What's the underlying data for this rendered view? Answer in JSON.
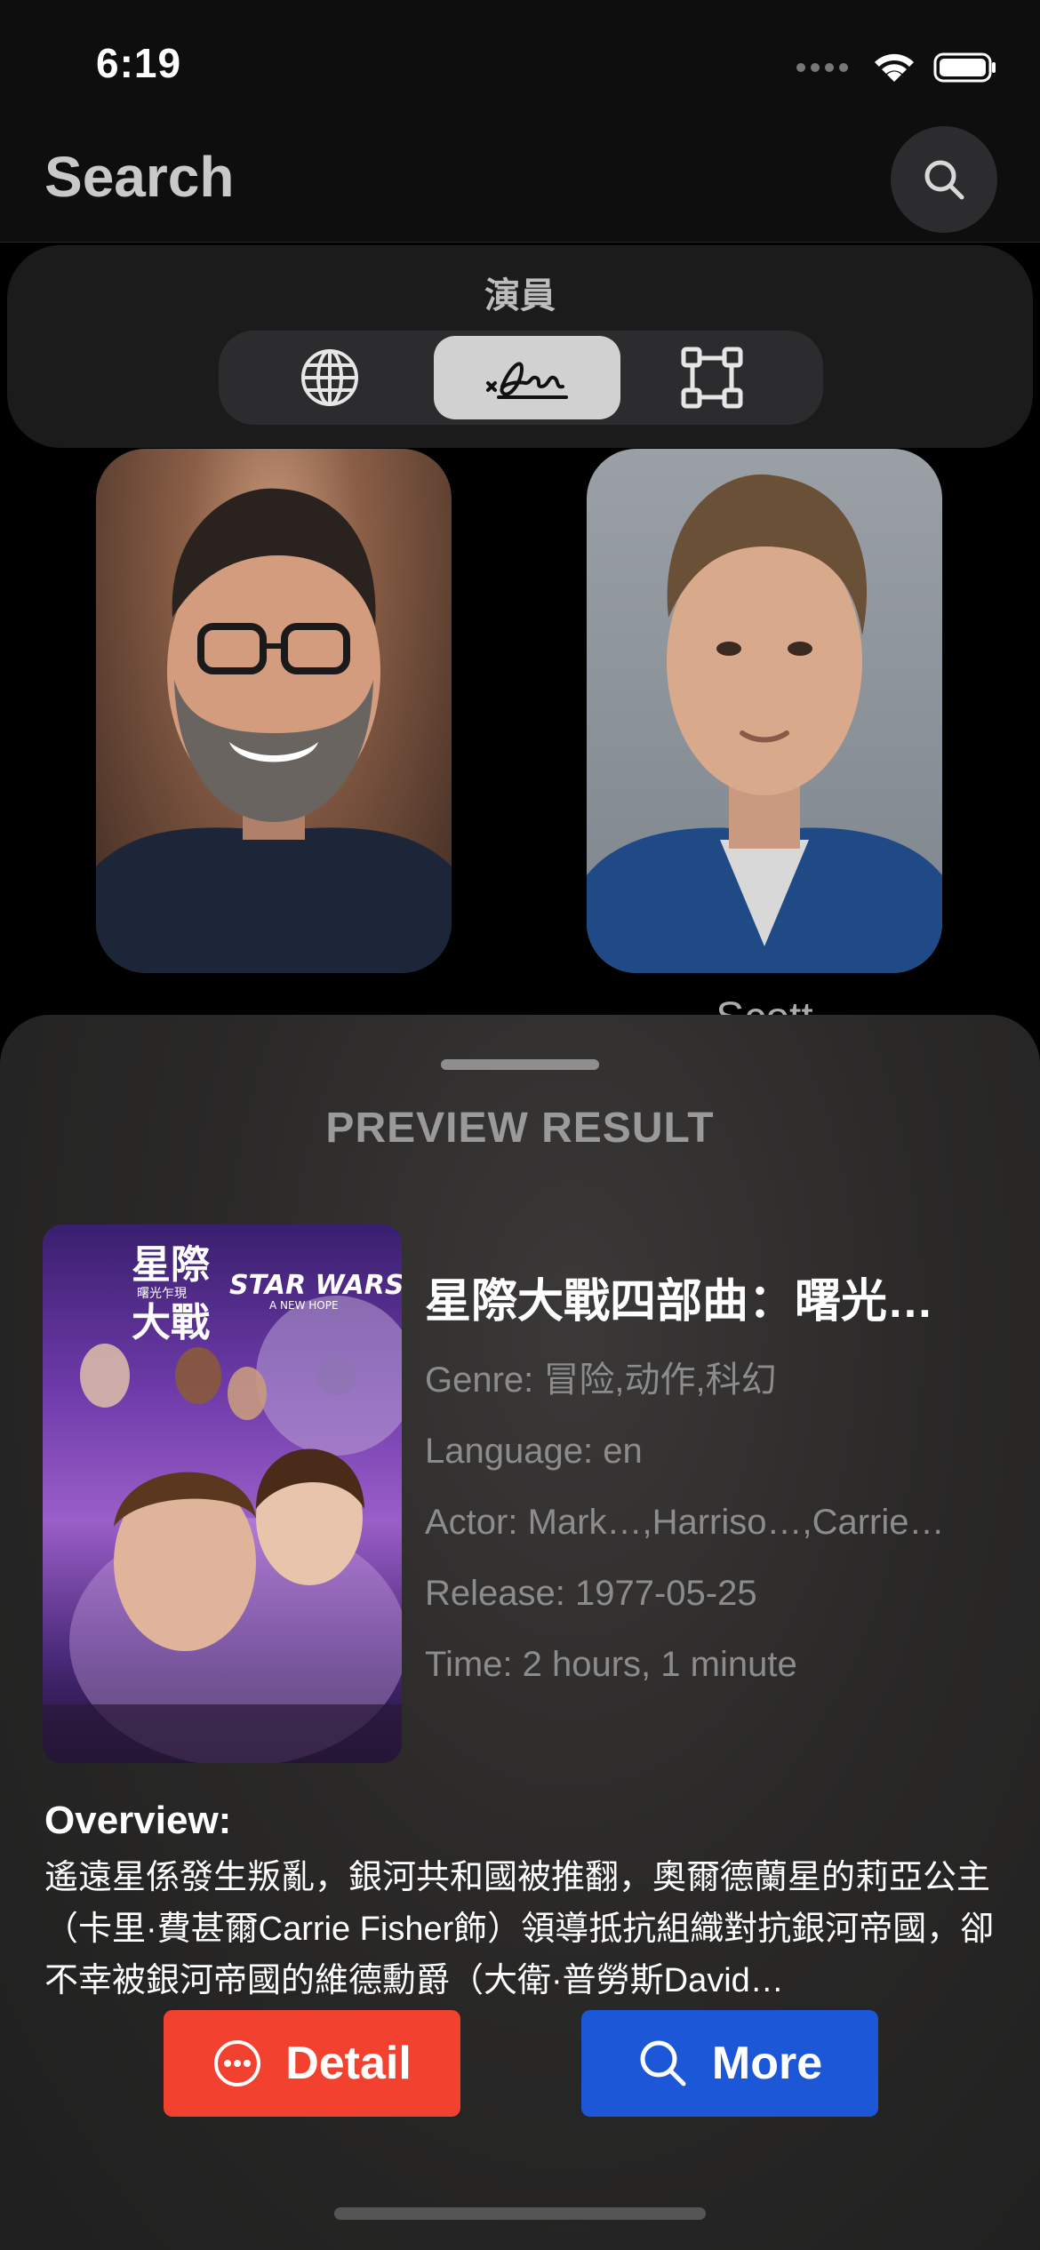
{
  "status_bar": {
    "time": "6:19",
    "icons": [
      "signal-dots-icon",
      "wifi-icon",
      "battery-icon"
    ]
  },
  "nav": {
    "title": "Search",
    "search_icon": "search-icon"
  },
  "filter": {
    "title": "演員",
    "segments": [
      {
        "icon": "globe-icon",
        "selected": false
      },
      {
        "icon": "signature-icon",
        "selected": true
      },
      {
        "icon": "crop-frame-icon",
        "selected": false
      }
    ]
  },
  "actors": [
    {
      "name": ""
    },
    {
      "name": "Scott"
    }
  ],
  "preview": {
    "heading": "PREVIEW RESULT",
    "title": "星際大戰四部曲：曙光…",
    "genre": "Genre: 冒险,动作,科幻",
    "language": "Language: en",
    "actor": "Actor: Mark…,Harriso…,Carrie…",
    "release": "Release: 1977-05-25",
    "time": "Time: 2 hours, 1 minute",
    "overview_label": "Overview:",
    "overview_text": "遙遠星係發生叛亂，銀河共和國被推翻，奧爾德蘭星的莉亞公主（卡里·費甚爾Carrie Fisher飾）領導抵抗組織對抗銀河帝國，卻不幸被銀河帝國的維德勳爵（大衛·普勞斯David…",
    "poster_text": {
      "zh_title_1": "星際",
      "zh_subtitle": "曙光乍現",
      "zh_title_2": "大戰",
      "star_wars": "STAR WARS",
      "new_hope": "A NEW HOPE"
    }
  },
  "buttons": {
    "detail_label": "Detail",
    "more_label": "More"
  },
  "colors": {
    "detail_button": "#f2412f",
    "more_button": "#1c57d8",
    "background": "#000000",
    "sheet": "#2a2928"
  }
}
